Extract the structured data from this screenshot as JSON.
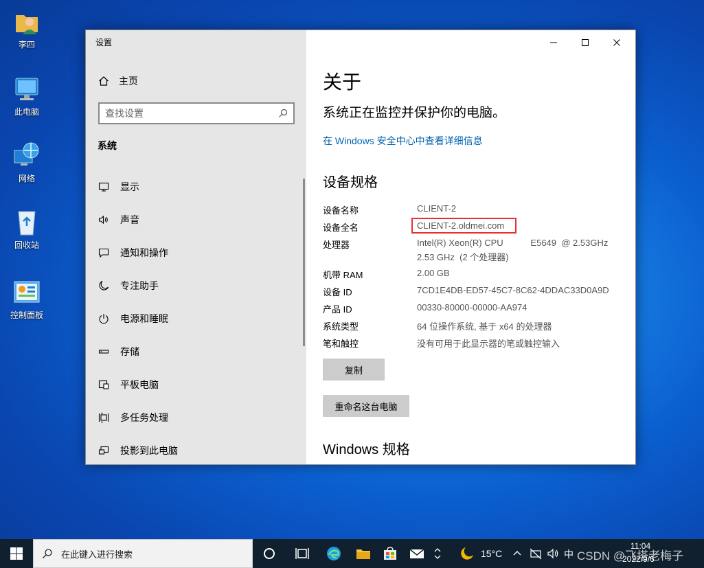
{
  "desktop": {
    "icons": [
      {
        "label": "李四"
      },
      {
        "label": "此电脑"
      },
      {
        "label": "网络"
      },
      {
        "label": "回收站"
      },
      {
        "label": "控制面板"
      }
    ]
  },
  "window": {
    "title": "设置",
    "home_label": "主页",
    "search_placeholder": "查找设置",
    "section_header": "系统",
    "nav_items": [
      {
        "label": "显示",
        "icon": "monitor-icon"
      },
      {
        "label": "声音",
        "icon": "speaker-icon"
      },
      {
        "label": "通知和操作",
        "icon": "notification-icon"
      },
      {
        "label": "专注助手",
        "icon": "moon-icon"
      },
      {
        "label": "电源和睡眠",
        "icon": "power-icon"
      },
      {
        "label": "存储",
        "icon": "storage-icon"
      },
      {
        "label": "平板电脑",
        "icon": "tablet-icon"
      },
      {
        "label": "多任务处理",
        "icon": "multitask-icon"
      },
      {
        "label": "投影到此电脑",
        "icon": "project-icon"
      }
    ]
  },
  "content": {
    "title": "关于",
    "subtitle": "系统正在监控并保护你的电脑。",
    "security_link": "在 Windows 安全中心中查看详细信息",
    "specs_heading": "设备规格",
    "specs": [
      {
        "label": "设备名称",
        "value": "CLIENT-2"
      },
      {
        "label": "设备全名",
        "value": "CLIENT-2.oldmei.com"
      },
      {
        "label": "处理器",
        "value": "Intel(R) Xeon(R) CPU           E5649  @ 2.53GHz",
        "value2": "2.53 GHz  (2 个处理器)"
      },
      {
        "label": "机带 RAM",
        "value": "2.00 GB"
      },
      {
        "label": "设备 ID",
        "value": "7CD1E4DB-ED57-45C7-8C62-4DDAC33D0A9D"
      },
      {
        "label": "产品 ID",
        "value": "00330-80000-00000-AA974"
      },
      {
        "label": "系统类型",
        "value": "64 位操作系统, 基于 x64 的处理器"
      },
      {
        "label": "笔和触控",
        "value": "没有可用于此显示器的笔或触控输入"
      }
    ],
    "copy_button": "复制",
    "rename_button": "重命名这台电脑",
    "windows_spec_heading": "Windows 规格"
  },
  "taskbar": {
    "search_placeholder": "在此键入进行搜索",
    "weather": "15°C",
    "time": "11:04",
    "date": "2022/9/6",
    "ime": "中",
    "watermark": "CSDN @飞塔老梅子"
  },
  "colors": {
    "accent": "#0063b1",
    "highlight_box": "#e33131",
    "sidebar_bg": "#e6e6e6",
    "taskbar_bg": "#10202f"
  }
}
